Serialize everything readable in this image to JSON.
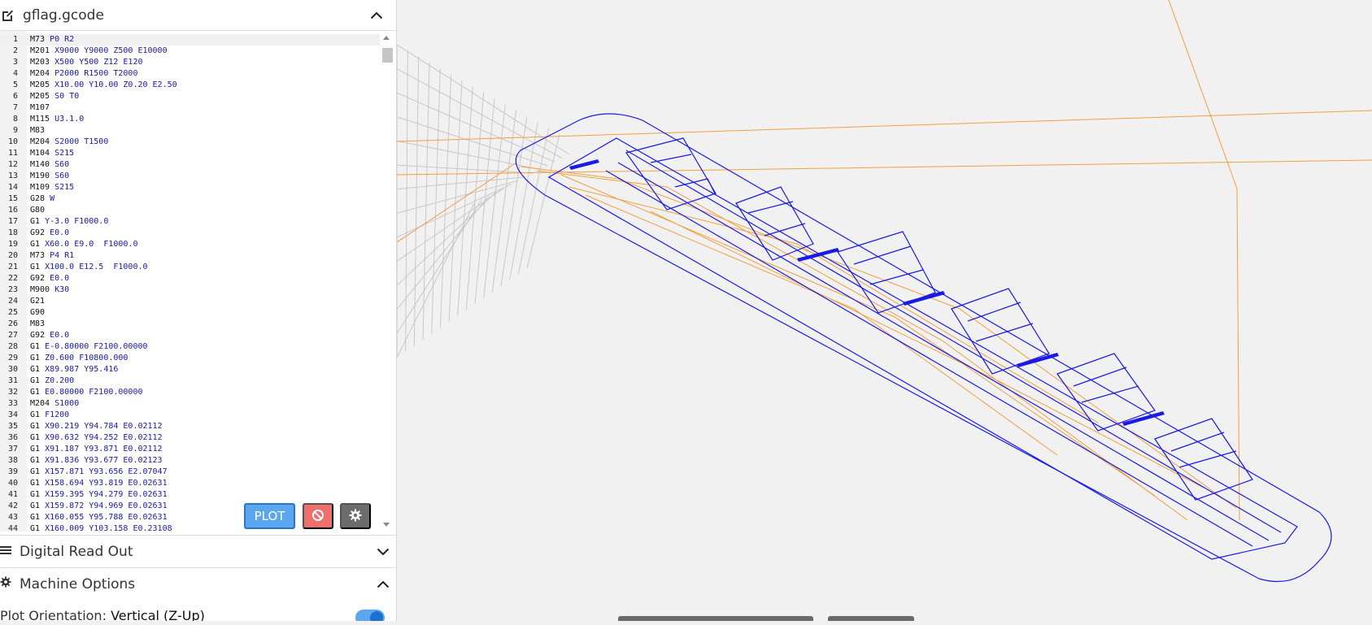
{
  "editor": {
    "filename": "gflag.gcode",
    "lines": [
      {
        "n": "1",
        "cmd": "M73",
        "args": "P0 R2"
      },
      {
        "n": "2",
        "cmd": "M201",
        "args": "X9000 Y9000 Z500 E10000"
      },
      {
        "n": "3",
        "cmd": "M203",
        "args": "X500 Y500 Z12 E120"
      },
      {
        "n": "4",
        "cmd": "M204",
        "args": "P2000 R1500 T2000"
      },
      {
        "n": "5",
        "cmd": "M205",
        "args": "X10.00 Y10.00 Z0.20 E2.50"
      },
      {
        "n": "6",
        "cmd": "M205",
        "args": "S0 T0"
      },
      {
        "n": "7",
        "cmd": "M107",
        "args": ""
      },
      {
        "n": "8",
        "cmd": "M115",
        "args": "U3.1.0"
      },
      {
        "n": "9",
        "cmd": "M83",
        "args": ""
      },
      {
        "n": "10",
        "cmd": "M204",
        "args": "S2000 T1500"
      },
      {
        "n": "11",
        "cmd": "M104",
        "args": "S215"
      },
      {
        "n": "12",
        "cmd": "M140",
        "args": "S60"
      },
      {
        "n": "13",
        "cmd": "M190",
        "args": "S60"
      },
      {
        "n": "14",
        "cmd": "M109",
        "args": "S215"
      },
      {
        "n": "15",
        "cmd": "G28",
        "args": "W"
      },
      {
        "n": "16",
        "cmd": "G80",
        "args": ""
      },
      {
        "n": "17",
        "cmd": "G1",
        "args": "Y-3.0 F1000.0"
      },
      {
        "n": "18",
        "cmd": "G92",
        "args": "E0.0"
      },
      {
        "n": "19",
        "cmd": "G1",
        "args": "X60.0 E9.0  F1000.0"
      },
      {
        "n": "20",
        "cmd": "M73",
        "args": "P4 R1"
      },
      {
        "n": "21",
        "cmd": "G1",
        "args": "X100.0 E12.5  F1000.0"
      },
      {
        "n": "22",
        "cmd": "G92",
        "args": "E0.0"
      },
      {
        "n": "23",
        "cmd": "M900",
        "args": "K30"
      },
      {
        "n": "24",
        "cmd": "G21",
        "args": ""
      },
      {
        "n": "25",
        "cmd": "G90",
        "args": ""
      },
      {
        "n": "26",
        "cmd": "M83",
        "args": ""
      },
      {
        "n": "27",
        "cmd": "G92",
        "args": "E0.0"
      },
      {
        "n": "28",
        "cmd": "G1",
        "args": "E-0.80000 F2100.00000"
      },
      {
        "n": "29",
        "cmd": "G1",
        "args": "Z0.600 F10800.000"
      },
      {
        "n": "30",
        "cmd": "G1",
        "args": "X89.987 Y95.416"
      },
      {
        "n": "31",
        "cmd": "G1",
        "args": "Z0.200"
      },
      {
        "n": "32",
        "cmd": "G1",
        "args": "E0.80000 F2100.00000"
      },
      {
        "n": "33",
        "cmd": "M204",
        "args": "S1000"
      },
      {
        "n": "34",
        "cmd": "G1",
        "args": "F1200"
      },
      {
        "n": "35",
        "cmd": "G1",
        "args": "X90.219 Y94.784 E0.02112"
      },
      {
        "n": "36",
        "cmd": "G1",
        "args": "X90.632 Y94.252 E0.02112"
      },
      {
        "n": "37",
        "cmd": "G1",
        "args": "X91.187 Y93.871 E0.02112"
      },
      {
        "n": "38",
        "cmd": "G1",
        "args": "X91.836 Y93.677 E0.02123"
      },
      {
        "n": "39",
        "cmd": "G1",
        "args": "X157.871 Y93.656 E2.07047"
      },
      {
        "n": "40",
        "cmd": "G1",
        "args": "X158.694 Y93.819 E0.02631"
      },
      {
        "n": "41",
        "cmd": "G1",
        "args": "X159.395 Y94.279 E0.02631"
      },
      {
        "n": "42",
        "cmd": "G1",
        "args": "X159.872 Y94.969 E0.02631"
      },
      {
        "n": "43",
        "cmd": "G1",
        "args": "X160.055 Y95.788 E0.02631"
      },
      {
        "n": "44",
        "cmd": "G1",
        "args": "X160.009 Y103.158 E0.23108"
      }
    ],
    "plot_label": "PLOT"
  },
  "dro": {
    "title": "Digital Read Out"
  },
  "machine_options": {
    "title": "Machine Options",
    "orientation_label": "Plot Orientation:",
    "orientation_value": "Vertical (Z-Up)",
    "orientation_enabled": true
  },
  "icons": {
    "file": "edit-file-icon",
    "collapse": "chevron-up-icon",
    "expand": "chevron-down-icon",
    "stop": "ban-icon",
    "settings": "gear-icon",
    "menu": "bars-icon"
  },
  "colors": {
    "plot_button": "#5aa7ef",
    "stop_button": "#ef6f6f",
    "settings_button": "#6c6c6c",
    "toolpath": "#1a1ae6",
    "travel": "#f0a040",
    "grid": "#c8c8c8",
    "viewport_bg": "#f1f1f1"
  }
}
